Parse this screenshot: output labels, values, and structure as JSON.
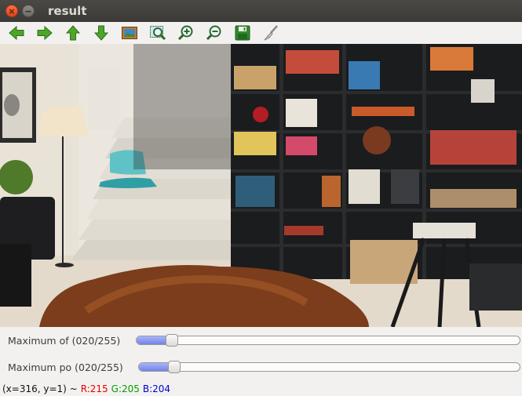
{
  "window": {
    "title": "result",
    "close_glyph": "×",
    "minimize_glyph": "−"
  },
  "toolbar": {
    "buttons": [
      {
        "name": "pan-left-button",
        "icon": "arrow-left-icon"
      },
      {
        "name": "pan-right-button",
        "icon": "arrow-right-icon"
      },
      {
        "name": "pan-up-button",
        "icon": "arrow-up-icon"
      },
      {
        "name": "pan-down-button",
        "icon": "arrow-down-icon"
      },
      {
        "name": "zoom-fit-button",
        "icon": "picture-icon"
      },
      {
        "name": "zoom-actual-button",
        "icon": "zoom-select-icon"
      },
      {
        "name": "zoom-in-button",
        "icon": "zoom-in-icon"
      },
      {
        "name": "zoom-out-button",
        "icon": "zoom-out-icon"
      },
      {
        "name": "save-button",
        "icon": "floppy-disk-icon"
      },
      {
        "name": "properties-button",
        "icon": "brush-icon"
      }
    ]
  },
  "image": {
    "description_colors": {
      "wall": "#ece8e0",
      "shelf": "#1c1d1f",
      "rug": "#7a3f1d",
      "floor": "#e6dccd"
    }
  },
  "trackbars": [
    {
      "label": "Maximum of (020/255)",
      "value": 20,
      "max": 255
    },
    {
      "label": "Maximum po (020/255)",
      "value": 20,
      "max": 255
    }
  ],
  "status": {
    "coords": "(x=316, y=1) ~",
    "r": "R:215",
    "g": "G:205",
    "b": "B:204"
  },
  "colors": {
    "accent_fill": "#7383eb",
    "red_text": "#e40000",
    "green_text": "#00a000",
    "blue_text": "#0000d0"
  }
}
